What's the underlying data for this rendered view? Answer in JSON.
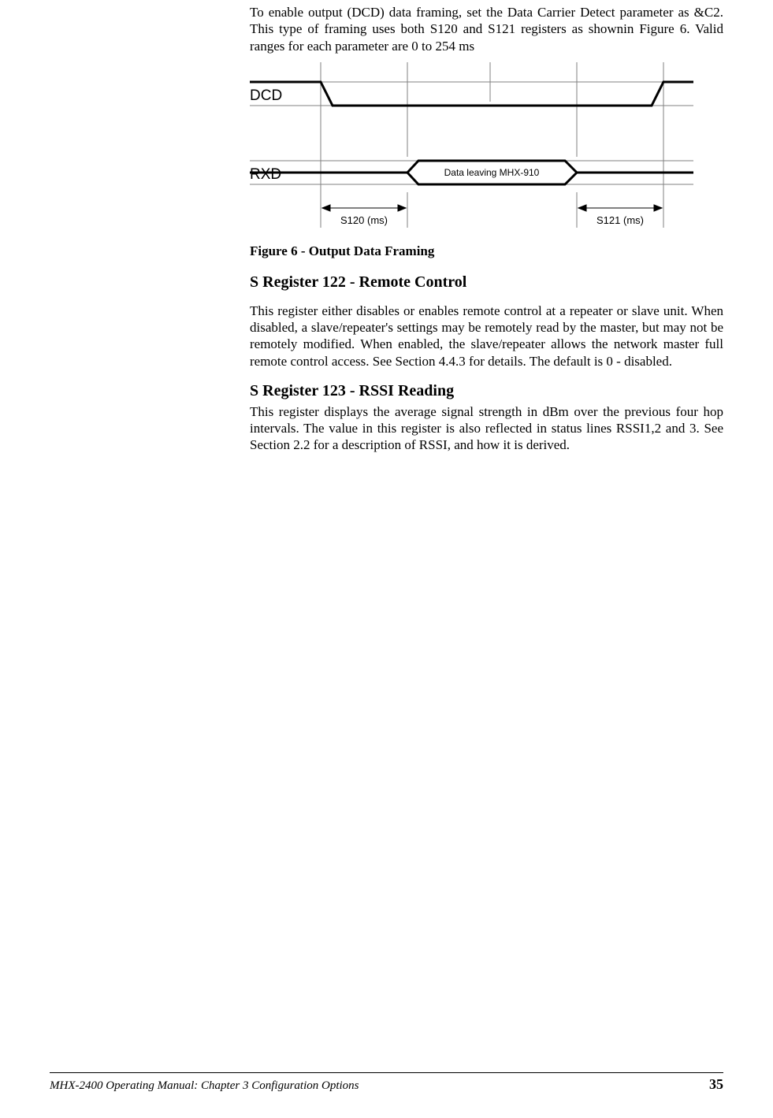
{
  "intro_para": "To enable output (DCD) data framing, set the Data Carrier Detect parameter as &C2.  This type of framing uses both S120 and S121 registers as shownin Figure 6.  Valid ranges for each parameter are 0 to 254 ms",
  "figure": {
    "dcd_label": "DCD",
    "rxd_label": "RXD",
    "data_box": "Data leaving MHX-910",
    "s120": "S120 (ms)",
    "s121": "S121 (ms)",
    "caption": "Figure 6 - Output Data Framing"
  },
  "section1": {
    "heading": "S Register 122  -  Remote Control",
    "body": "This register either disables or enables remote control at a repeater or slave unit.  When disabled, a slave/repeater's settings may be remotely read by the master,  but  may  not  be  remotely  modified.    When  enabled,  the slave/repeater  allows  the  network  master  full  remote  control  access.    See Section 4.4.3 for details.  The default is 0 - disabled."
  },
  "section2": {
    "heading": "S Register 123  -  RSSI Reading",
    "body": "This register displays the average signal strength in dBm over the previous four hop intervals.  The value in this register is also reflected in status lines RSSI1,2  and  3.    See  Section  2.2  for  a  description  of  RSSI,  and  how  it  is derived."
  },
  "footer": {
    "left": "MHX-2400 Operating Manual: Chapter 3 Configuration Options",
    "page": "35"
  }
}
